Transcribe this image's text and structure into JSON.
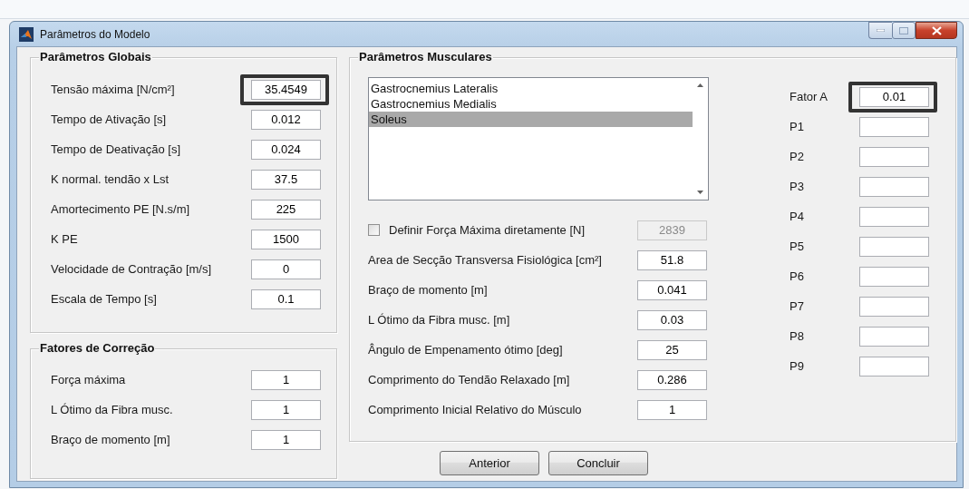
{
  "window": {
    "title": "Parâmetros do Modelo"
  },
  "global_params": {
    "title": "Parâmetros Globais",
    "rows": [
      {
        "label": "Tensão máxima [N/cm²]",
        "value": "35.4549",
        "highlighted": true
      },
      {
        "label": "Tempo de Ativação [s]",
        "value": "0.012",
        "highlighted": false
      },
      {
        "label": "Tempo de Deativação [s]",
        "value": "0.024",
        "highlighted": false
      },
      {
        "label": "K normal. tendão x Lst",
        "value": "37.5",
        "highlighted": false
      },
      {
        "label": "Amortecimento PE [N.s/m]",
        "value": "225",
        "highlighted": false
      },
      {
        "label": "K PE",
        "value": "1500",
        "highlighted": false
      },
      {
        "label": "Velocidade de Contração [m/s]",
        "value": "0",
        "highlighted": false
      },
      {
        "label": "Escala de Tempo [s]",
        "value": "0.1",
        "highlighted": false
      }
    ]
  },
  "correction_factors": {
    "title": "Fatores de Correção",
    "rows": [
      {
        "label": "Força máxima",
        "value": "1",
        "highlighted": false
      },
      {
        "label": "L Ótimo da Fibra musc.",
        "value": "1",
        "highlighted": false
      },
      {
        "label": "Braço de momento [m]",
        "value": "1",
        "highlighted": false
      }
    ]
  },
  "muscle_params": {
    "title": "Parâmetros Musculares",
    "muscles": [
      {
        "label": "Gastrocnemius Lateralis",
        "selected": false
      },
      {
        "label": "Gastrocnemius Medialis",
        "selected": false
      },
      {
        "label": "Soleus",
        "selected": true
      }
    ],
    "max_force": {
      "label": "Definir Força Máxima diretamente [N]",
      "checked": false,
      "value": "2839",
      "disabled": true
    },
    "rows": [
      {
        "label": "Area de Secção Transversa Fisiológica [cm²]",
        "value": "51.8",
        "highlighted": false
      },
      {
        "label": "Braço de momento [m]",
        "value": "0.041",
        "highlighted": false
      },
      {
        "label": "L Ótimo da Fibra musc. [m]",
        "value": "0.03",
        "highlighted": false
      },
      {
        "label": "Ângulo de Empenamento ótimo [deg]",
        "value": "25",
        "highlighted": false
      },
      {
        "label": "Comprimento do Tendão Relaxado [m]",
        "value": "0.286",
        "highlighted": false
      },
      {
        "label": "Comprimento Inicial Relativo do Músculo",
        "value": "1",
        "highlighted": false
      }
    ],
    "factors": [
      {
        "label": "Fator A",
        "value": "0.01",
        "highlighted": true
      },
      {
        "label": "P1",
        "highlighted": false
      },
      {
        "label": "P2",
        "highlighted": false
      },
      {
        "label": "P3",
        "highlighted": false
      },
      {
        "label": "P4",
        "highlighted": false
      },
      {
        "label": "P5",
        "highlighted": false
      },
      {
        "label": "P6",
        "highlighted": false
      },
      {
        "label": "P7",
        "highlighted": false
      },
      {
        "label": "P8",
        "highlighted": false
      },
      {
        "label": "P9",
        "highlighted": false
      }
    ]
  },
  "buttons": [
    "Anterior",
    "Concluir"
  ]
}
